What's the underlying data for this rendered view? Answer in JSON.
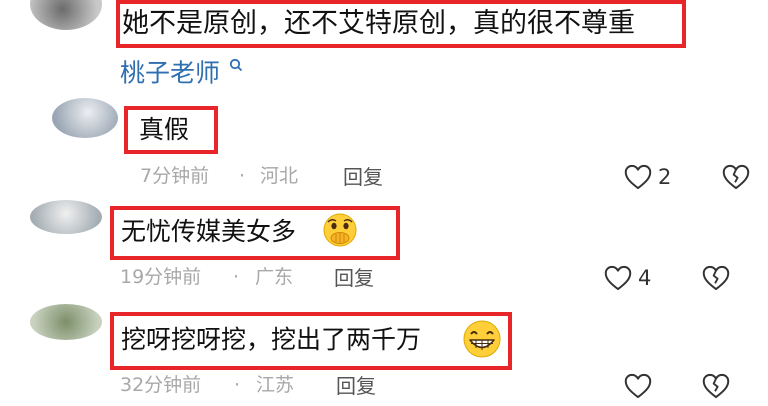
{
  "comments": [
    {
      "text": "她不是原创，还不艾特原创，真的很不尊重",
      "mention": "桃子老师"
    },
    {
      "text": "真假",
      "time": "7分钟前",
      "location": "河北",
      "reply_label": "回复",
      "like_count": "2"
    },
    {
      "text": "无忧传媒美女多",
      "emoji": "anguished-face-with-hands-over-mouth",
      "time": "19分钟前",
      "location": "广东",
      "reply_label": "回复",
      "like_count": "4"
    },
    {
      "text": "挖呀挖呀挖，挖出了两千万",
      "emoji": "grinning-face",
      "time": "32分钟前",
      "location": "江苏",
      "reply_label": "回复",
      "like_count": ""
    }
  ],
  "separator": "·",
  "colors": {
    "highlight_border": "#e8262a",
    "mention_link": "#2f6fb0",
    "meta_text": "#a8a8a8"
  }
}
